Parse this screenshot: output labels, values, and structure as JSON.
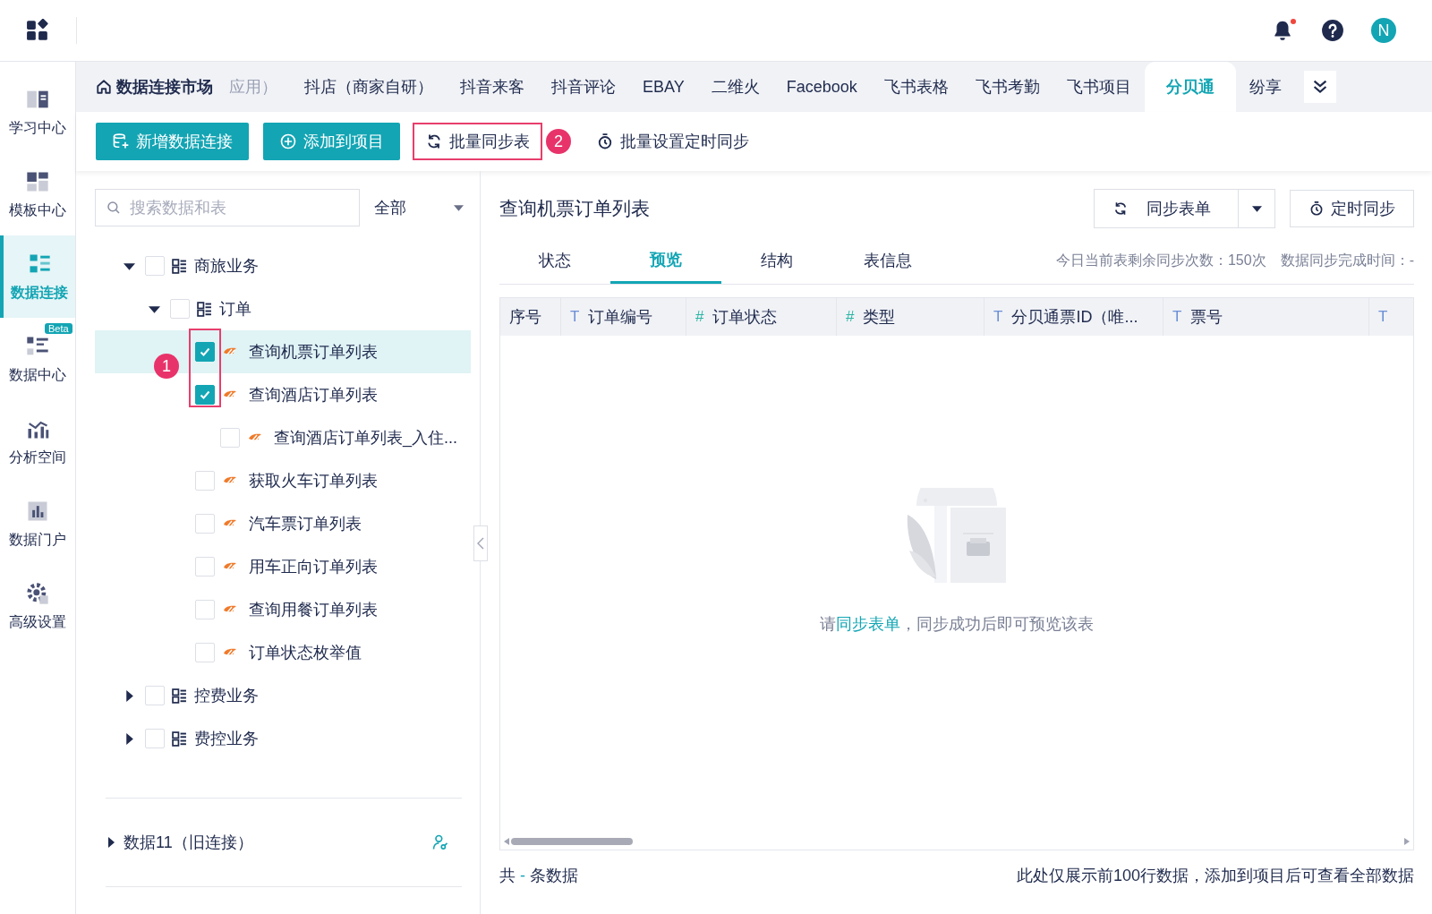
{
  "app_bar": {
    "avatar": "N",
    "notification_dot": true
  },
  "nav": [
    {
      "label": "学习中心",
      "selected": false
    },
    {
      "label": "模板中心",
      "selected": false
    },
    {
      "label": "数据连接",
      "selected": true
    },
    {
      "label": "数据中心",
      "selected": false,
      "badge": "Beta"
    },
    {
      "label": "分析空间",
      "selected": false
    },
    {
      "label": "数据门户",
      "selected": false
    },
    {
      "label": "高级设置",
      "selected": false
    }
  ],
  "tab_bar": {
    "home": "数据连接市场",
    "tabs": [
      {
        "label": "应用）",
        "selected": false,
        "faded": true
      },
      {
        "label": "抖店（商家自研）",
        "selected": false,
        "faded": false
      },
      {
        "label": "抖音来客",
        "selected": false,
        "faded": false
      },
      {
        "label": "抖音评论",
        "selected": false,
        "faded": false
      },
      {
        "label": "EBAY",
        "selected": false,
        "faded": false
      },
      {
        "label": "二维火",
        "selected": false,
        "faded": false
      },
      {
        "label": "Facebook",
        "selected": false,
        "faded": false
      },
      {
        "label": "飞书表格",
        "selected": false,
        "faded": false
      },
      {
        "label": "飞书考勤",
        "selected": false,
        "faded": false
      },
      {
        "label": "飞书项目",
        "selected": false,
        "faded": false
      },
      {
        "label": "分贝通",
        "selected": true,
        "faded": false
      },
      {
        "label": "纷享",
        "selected": false,
        "faded": false
      }
    ]
  },
  "toolbar": [
    {
      "label": "新增数据连接",
      "kind": "primary"
    },
    {
      "label": "添加到项目",
      "kind": "primary"
    },
    {
      "label": "批量同步表",
      "kind": "text",
      "callout": "2"
    },
    {
      "label": "批量设置定时同步",
      "kind": "text"
    }
  ],
  "left_panel": {
    "search": {
      "placeholder": "搜索数据和表"
    },
    "filter": "全部",
    "callout": "1",
    "tree": [
      {
        "label": "商旅业务",
        "kind": "folder",
        "expanded": true,
        "checked": false,
        "selected": false,
        "children": [
          {
            "label": "订单",
            "kind": "folder",
            "expanded": true,
            "checked": false,
            "selected": false,
            "children": [
              {
                "label": "查询机票订单列表",
                "kind": "table",
                "checked": true,
                "selected": true
              },
              {
                "label": "查询酒店订单列表",
                "kind": "table",
                "checked": true,
                "selected": false,
                "children": [
                  {
                    "label": "查询酒店订单列表_入住...",
                    "kind": "table",
                    "checked": false,
                    "selected": false
                  }
                ]
              },
              {
                "label": "获取火车订单列表",
                "kind": "table",
                "checked": false,
                "selected": false
              },
              {
                "label": "汽车票订单列表",
                "kind": "table",
                "checked": false,
                "selected": false
              },
              {
                "label": "用车正向订单列表",
                "kind": "table",
                "checked": false,
                "selected": false
              },
              {
                "label": "查询用餐订单列表",
                "kind": "table",
                "checked": false,
                "selected": false
              },
              {
                "label": "订单状态枚举值",
                "kind": "table",
                "checked": false,
                "selected": false
              }
            ]
          }
        ]
      },
      {
        "label": "控费业务",
        "kind": "folder",
        "expanded": false,
        "checked": false,
        "selected": false
      },
      {
        "label": "费控业务",
        "kind": "folder",
        "expanded": false,
        "checked": false,
        "selected": false
      }
    ],
    "connections": [
      {
        "label": "数据11（旧连接）",
        "expanded": false
      }
    ]
  },
  "right_panel": {
    "title": "查询机票订单列表",
    "sync_button": "同步表单",
    "schedule_button": "定时同步",
    "tabs": [
      {
        "label": "状态",
        "selected": false
      },
      {
        "label": "预览",
        "selected": true
      },
      {
        "label": "结构",
        "selected": false
      },
      {
        "label": "表信息",
        "selected": false
      }
    ],
    "info": [
      "今日当前表剩余同步次数：150次",
      "数据同步完成时间：-"
    ],
    "table": {
      "columns": [
        {
          "label": "序号"
        },
        {
          "label": "订单编号",
          "kind": "text",
          "marker": "T"
        },
        {
          "label": "订单状态",
          "kind": "number",
          "marker": "#"
        },
        {
          "label": "类型",
          "kind": "number",
          "marker": "#"
        },
        {
          "label": "分贝通票ID（唯...",
          "kind": "text",
          "marker": "T"
        },
        {
          "label": "票号",
          "kind": "text",
          "marker": "T"
        },
        {
          "kind": "text",
          "marker": "T"
        }
      ],
      "empty": {
        "before": "请",
        "link": "同步表单",
        "after": "，同步成功后即可预览该表"
      }
    },
    "footer": {
      "prefix": "共",
      "count": "-",
      "suffix": "条数据",
      "note": "此处仅展示前100行数据，添加到项目后可查看全部数据"
    }
  }
}
